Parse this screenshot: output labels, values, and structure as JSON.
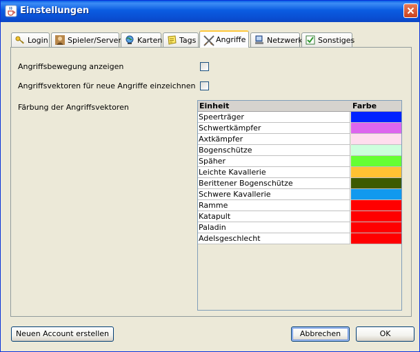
{
  "window": {
    "title": "Einstellungen",
    "icon": "java-cup-icon",
    "close_icon": "close-icon"
  },
  "tabs": [
    {
      "label": "Login",
      "icon": "key-icon",
      "active": false
    },
    {
      "label": "Spieler/Server",
      "icon": "player-avatar-icon",
      "active": false
    },
    {
      "label": "Karten",
      "icon": "globe-icon",
      "active": false
    },
    {
      "label": "Tags",
      "icon": "note-icon",
      "active": false
    },
    {
      "label": "Angriffe",
      "icon": "crossed-swords-icon",
      "active": true
    },
    {
      "label": "Netzwerk",
      "icon": "network-icon",
      "active": false
    },
    {
      "label": "Sonstiges",
      "icon": "checklist-icon",
      "active": false
    }
  ],
  "options": {
    "show_attack_movement": {
      "label": "Angriffsbewegung anzeigen",
      "checked": false
    },
    "draw_vectors": {
      "label": "Angriffsvektoren für neue Angriffe einzeichnen",
      "checked": false
    },
    "coloring_label": "Färbung der Angriffsvektoren"
  },
  "table": {
    "columns": [
      "Einheit",
      "Farbe"
    ],
    "rows": [
      {
        "unit": "Speerträger",
        "color": "#0022FF"
      },
      {
        "unit": "Schwertkämpfer",
        "color": "#DD66EE"
      },
      {
        "unit": "Axtkämpfer",
        "color": "#FFDDEE"
      },
      {
        "unit": "Bogenschütze",
        "color": "#CCFFDD"
      },
      {
        "unit": "Späher",
        "color": "#66FF33"
      },
      {
        "unit": "Leichte Kavallerie",
        "color": "#FFC233"
      },
      {
        "unit": "Berittener Bogenschütze",
        "color": "#3D5A00"
      },
      {
        "unit": "Schwere Kavallerie",
        "color": "#1199EE"
      },
      {
        "unit": "Ramme",
        "color": "#FF0000"
      },
      {
        "unit": "Katapult",
        "color": "#FF0000"
      },
      {
        "unit": "Paladin",
        "color": "#FF0000"
      },
      {
        "unit": "Adelsgeschlecht",
        "color": "#FF0000"
      }
    ]
  },
  "buttons": {
    "new_account": "Neuen Account erstellen",
    "cancel": "Abbrechen",
    "ok": "OK"
  }
}
